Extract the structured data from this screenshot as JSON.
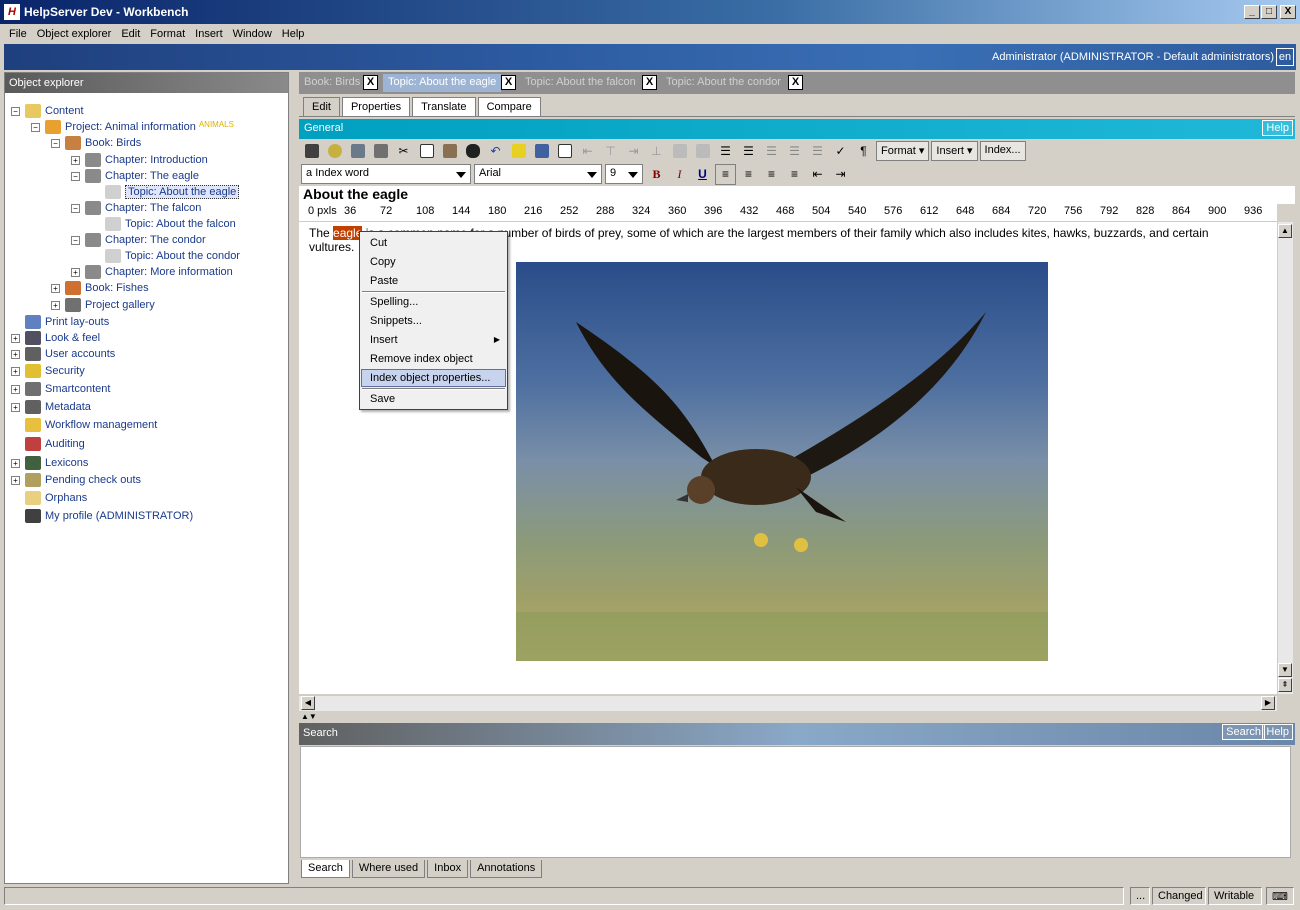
{
  "window": {
    "title": "HelpServer Dev - Workbench",
    "min": "_",
    "max": "□",
    "close": "X"
  },
  "menu": [
    "File",
    "Object explorer",
    "Edit",
    "Format",
    "Insert",
    "Window",
    "Help"
  ],
  "banner": {
    "user": "Administrator (ADMINISTRATOR - Default administrators)",
    "lang": "en"
  },
  "explorer": {
    "header": "Object explorer",
    "items": [
      {
        "label": "Content",
        "badge": ""
      },
      {
        "label": "Project: Animal information",
        "badge": "ANIMALS"
      },
      {
        "label": "Book: Birds",
        "badge": ""
      },
      {
        "label": "Chapter: Introduction",
        "badge": ""
      },
      {
        "label": "Chapter: The eagle",
        "badge": ""
      },
      {
        "label": "Topic: About the eagle",
        "badge": ""
      },
      {
        "label": "Chapter: The falcon",
        "badge": ""
      },
      {
        "label": "Topic: About the falcon",
        "badge": ""
      },
      {
        "label": "Chapter: The condor",
        "badge": ""
      },
      {
        "label": "Topic: About the condor",
        "badge": ""
      },
      {
        "label": "Chapter: More information",
        "badge": ""
      },
      {
        "label": "Book: Fishes",
        "badge": ""
      },
      {
        "label": "Project gallery",
        "badge": ""
      },
      {
        "label": "Print lay-outs",
        "badge": ""
      },
      {
        "label": "Look & feel",
        "badge": ""
      },
      {
        "label": "User accounts",
        "badge": ""
      },
      {
        "label": "Security",
        "badge": ""
      },
      {
        "label": "Smartcontent",
        "badge": ""
      },
      {
        "label": "Metadata",
        "badge": ""
      },
      {
        "label": "Workflow management",
        "badge": ""
      },
      {
        "label": "Auditing",
        "badge": ""
      },
      {
        "label": "Lexicons",
        "badge": ""
      },
      {
        "label": "Pending check outs",
        "badge": ""
      },
      {
        "label": "Orphans",
        "badge": ""
      },
      {
        "label": "My profile (ADMINISTRATOR)",
        "badge": ""
      }
    ]
  },
  "doc_tabs": [
    "Book: Birds",
    "Topic: About the eagle",
    "Topic: About the falcon",
    "Topic: About the condor"
  ],
  "close_x": "X",
  "sub_tabs": [
    "Edit",
    "Properties",
    "Translate",
    "Compare"
  ],
  "general": {
    "label": "General",
    "help": "Help"
  },
  "toolbar": {
    "format": "Format",
    "insert": "Insert",
    "index": "Index...",
    "pilcrow": "¶"
  },
  "formatting": {
    "style": "Index word",
    "font": "Arial",
    "size": "9",
    "bold": "B",
    "italic": "I",
    "underline": "U"
  },
  "document": {
    "title": "About the eagle",
    "text_before": "The ",
    "text_highlight": "eagle",
    "text_after": " is a common name for a number of birds of prey, some of which are the largest members of their family which also includes kites, hawks, buzzards, and certain vultures."
  },
  "ruler": [
    "0 pxls",
    "36",
    "72",
    "108",
    "144",
    "180",
    "216",
    "252",
    "288",
    "324",
    "360",
    "396",
    "432",
    "468",
    "504",
    "540",
    "576",
    "612",
    "648",
    "684",
    "720",
    "756",
    "792",
    "828",
    "864",
    "900",
    "936"
  ],
  "context_menu": [
    "Cut",
    "Copy",
    "Paste",
    "Spelling...",
    "Snippets...",
    "Insert",
    "Remove index object",
    "Index object properties...",
    "Save"
  ],
  "search": {
    "label": "Search",
    "button": "Search",
    "help": "Help"
  },
  "bottom_tabs": [
    "Search",
    "Where used",
    "Inbox",
    "Annotations"
  ],
  "status": {
    "dots": "...",
    "changed": "Changed",
    "writable": "Writable"
  }
}
